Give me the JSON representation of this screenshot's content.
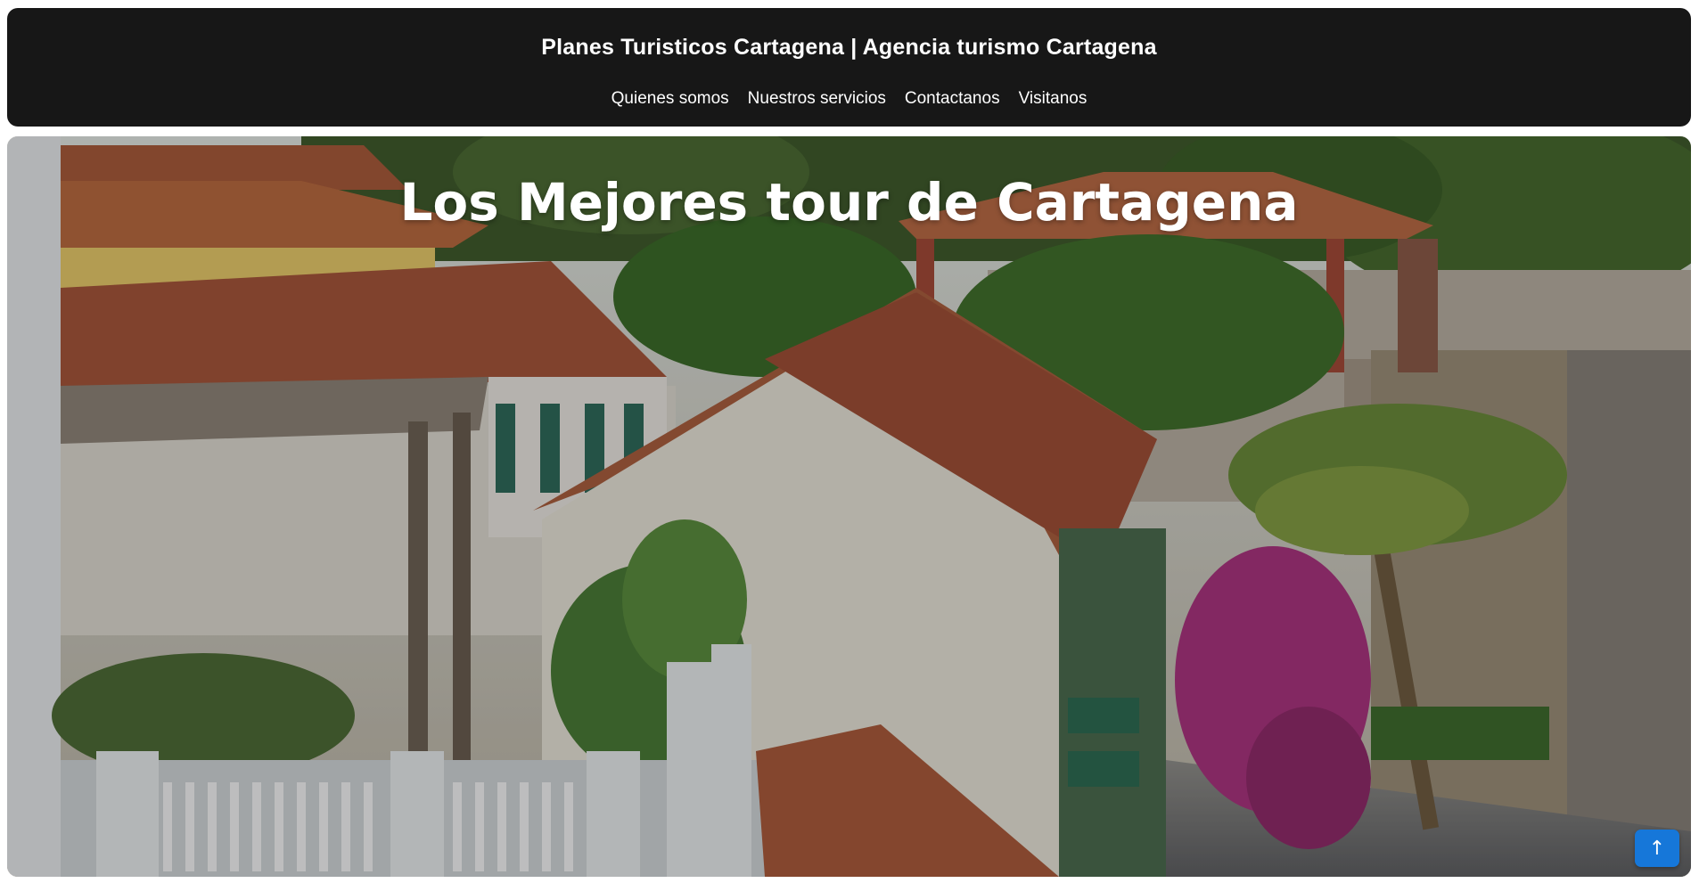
{
  "header": {
    "title": "Planes Turisticos Cartagena | Agencia turismo Cartagena",
    "nav": [
      {
        "label": "Quienes somos"
      },
      {
        "label": "Nuestros servicios"
      },
      {
        "label": "Contactanos"
      },
      {
        "label": "Visitanos"
      }
    ]
  },
  "hero": {
    "title": "Los Mejores tour de Cartagena"
  },
  "scroll_top": {
    "icon": "arrow-up-icon",
    "glyph": "↑"
  },
  "colors": {
    "header_bg": "#171717",
    "accent": "#1677d9"
  }
}
